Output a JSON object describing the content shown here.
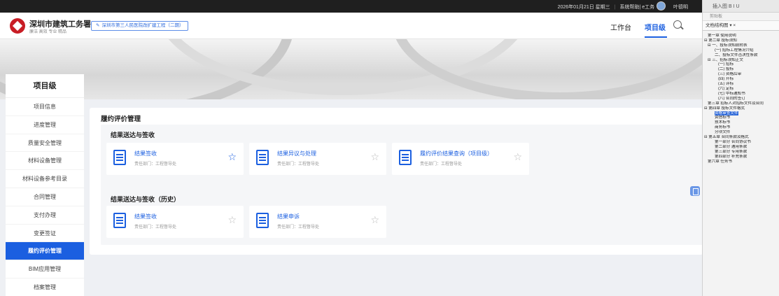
{
  "topbar": {
    "date": "2026年01月21日 星期三",
    "system": "系统帮助| e工务",
    "user": "叶德明"
  },
  "header": {
    "org_name": "深圳市建筑工务署",
    "org_slogan": "廉洁 高效 专业 精品",
    "project_tag": "深圳市第三人民医院改扩建工程（二期）",
    "nav_workbench": "工作台",
    "nav_project": "项目级"
  },
  "sidebar": {
    "title": "项目级",
    "items": [
      {
        "label": "项目信息"
      },
      {
        "label": "进度管理"
      },
      {
        "label": "质量安全管理"
      },
      {
        "label": "材料设备管理"
      },
      {
        "label": "材料设备参考目录"
      },
      {
        "label": "合同管理"
      },
      {
        "label": "支付办理"
      },
      {
        "label": "变更签证"
      },
      {
        "label": "履约评价管理"
      },
      {
        "label": "BIM应用管理"
      },
      {
        "label": "档案管理"
      }
    ],
    "active_index": 8
  },
  "main": {
    "title": "履约评价管理",
    "sections": [
      {
        "title": "结果送达与签收",
        "cards": [
          {
            "title": "结果签收",
            "dept": "责任部门：工程督导处",
            "starred": true
          },
          {
            "title": "结果异议与处理",
            "dept": "责任部门：工程督导处",
            "starred": false
          },
          {
            "title": "履约评价结果查询（项目级）",
            "dept": "责任部门：工程督导处",
            "starred": false
          }
        ]
      },
      {
        "title": "结果送达与签收（历史）",
        "cards": [
          {
            "title": "结果签收",
            "dept": "责任部门：工程督导处",
            "starred": false
          },
          {
            "title": "结果申诉",
            "dept": "责任部门：工程督导处",
            "starred": false
          }
        ]
      }
    ]
  },
  "right_panel": {
    "toolbar": "插入图 B I U",
    "clipboard": "剪贴板",
    "nav_label": "文档结构图",
    "tree": [
      {
        "text": "第一章  使用说明",
        "indent": 1
      },
      {
        "text": "⊟ 第二章  投标须知",
        "indent": 0
      },
      {
        "text": "⊟ 一、投标须知前附表",
        "indent": 1
      },
      {
        "text": "(一) 招标工程情况介绍",
        "indent": 3
      },
      {
        "text": "二、投标文件否决性条款",
        "indent": 3
      },
      {
        "text": "⊟ 三、招标须知正文",
        "indent": 1
      },
      {
        "text": "(一) 招标",
        "indent": 4
      },
      {
        "text": "(二) 投标",
        "indent": 4
      },
      {
        "text": "(三) 资格后审",
        "indent": 4
      },
      {
        "text": "(四) 开标",
        "indent": 4
      },
      {
        "text": "(五) 评标",
        "indent": 4
      },
      {
        "text": "(六) 定标",
        "indent": 4
      },
      {
        "text": "(七) 中标通知书",
        "indent": 4
      },
      {
        "text": "(八) 合同的签订",
        "indent": 4
      },
      {
        "text": "第三章  招标人对招标文件及合同",
        "indent": 1
      },
      {
        "text": "⊟ 第四章  投标文件格式",
        "indent": 0
      },
      {
        "text": "资格审查文件",
        "indent": 3,
        "highlight": true
      },
      {
        "text": "资信标书",
        "indent": 3
      },
      {
        "text": "技术标书",
        "indent": 3
      },
      {
        "text": "商务标书",
        "indent": 3
      },
      {
        "text": "分项文件",
        "indent": 3
      },
      {
        "text": "⊟ 第五章  合同条款及格式",
        "indent": 0
      },
      {
        "text": "第一部分  合同协议书",
        "indent": 3
      },
      {
        "text": "第二部分  通用条款",
        "indent": 3
      },
      {
        "text": "第三部分  专用条款",
        "indent": 3
      },
      {
        "text": "第四部分  补充条款",
        "indent": 3
      },
      {
        "text": "",
        "indent": 0
      },
      {
        "text": "第六章  任务书",
        "indent": 1
      }
    ]
  },
  "colors": {
    "accent": "#1b5fe0",
    "brand_red": "#c81d25"
  }
}
